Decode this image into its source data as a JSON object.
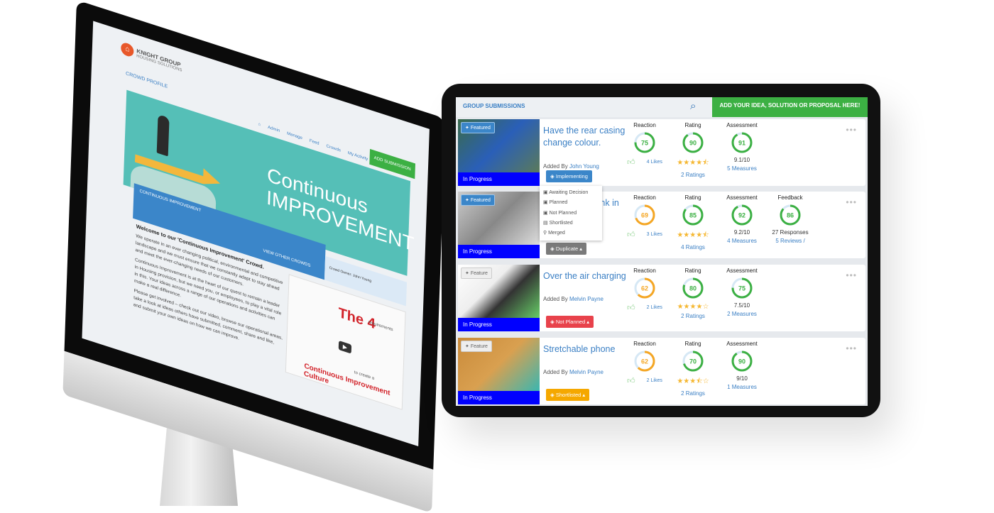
{
  "desktop": {
    "logo": {
      "title": "KNIGHT GROUP",
      "subtitle": "HOUSING SOLUTIONS"
    },
    "crowd_profile": "CROWD PROFILE",
    "nav": [
      "Admin",
      "Manage",
      "Feed",
      "Crowds",
      "My Activity"
    ],
    "banner": {
      "line1": "Continuous",
      "line2": "IMPROVEMENT"
    },
    "add_submission": "ADD SUBMISSION",
    "crowd_bar": "CONTINUOUS IMPROVEMENT",
    "view_other": "VIEW OTHER CROWDS",
    "owner": "Crowd Owner: John Young",
    "welcome": "Welcome to our 'Continuous Improvement' Crowd.",
    "paragraphs": [
      "We operate in an ever changing political, environmental and competitive landscape and we must ensure that we constantly adapt to stay ahead and meet the ever-changing needs of our customers.",
      "Continuous Improvement is at the heart of our quest to remain a leader in Housing provision, but we need you, or employees, to play a vital role in this. Your ideas across a range of our operations and activities can make a real difference.",
      "Please get involved – check out our video, browse our operational areas, take a look at ideas others have submitted, comment, share and like, and submit your own ideas on how we can improve."
    ],
    "video": {
      "big": "The 4",
      "small": "requirements",
      "to": "to create a",
      "culture": "Continuous Improvement Culture"
    }
  },
  "tablet": {
    "header": {
      "title": "GROUP SUBMISSIONS",
      "add_button": "ADD YOUR IDEA, SOLUTION OR PROPOSAL HERE!"
    },
    "dropdown": [
      "Awaiting Decision",
      "Planned",
      "Not Planned",
      "Shortlisted",
      "Merged"
    ],
    "colors": {
      "green": "#3cb043",
      "orange": "#f5a623",
      "blue": "#3b86c9",
      "red": "#e8424b",
      "gray": "#7a7a7a",
      "yellow": "#f5a800"
    },
    "cards": [
      {
        "featured": "Featured",
        "progress": "In Progress",
        "title": "Have the rear casing change colour.",
        "added_by": "Added By",
        "author": "John Young",
        "status": "Implementing",
        "reaction": {
          "label": "Reaction",
          "value": 75,
          "likes": "4 Likes"
        },
        "rating": {
          "label": "Rating",
          "value": 90,
          "stars": 4.5,
          "count": "2 Ratings"
        },
        "assessment": {
          "label": "Assessment",
          "value": 91,
          "score": "9.1/10",
          "measures": "5 Measures"
        }
      },
      {
        "featured": "Featured",
        "progress": "In Progress",
        "title": "...nk in",
        "added_by": "",
        "author": "",
        "status": "Duplicate ▴",
        "reaction": {
          "label": "Reaction",
          "value": 69,
          "likes": "3 Likes"
        },
        "rating": {
          "label": "Rating",
          "value": 85,
          "stars": 4.5,
          "count": "4 Ratings"
        },
        "assessment": {
          "label": "Assessment",
          "value": 92,
          "score": "9.2/10",
          "measures": "4 Measures"
        },
        "feedback": {
          "label": "Feedback",
          "value": 86,
          "responses": "27 Responses",
          "reviews": "5 Reviews /"
        }
      },
      {
        "featured": "Feature",
        "progress": "In Progress",
        "title": "Over the air charging",
        "added_by": "Added By",
        "author": "Melvin Payne",
        "status": "Not Planned ▴",
        "reaction": {
          "label": "Reaction",
          "value": 62,
          "likes": "2 Likes"
        },
        "rating": {
          "label": "Rating",
          "value": 80,
          "stars": 4,
          "count": "2 Ratings"
        },
        "assessment": {
          "label": "Assessment",
          "value": 75,
          "score": "7.5/10",
          "measures": "2 Measures"
        }
      },
      {
        "featured": "Feature",
        "progress": "In Progress",
        "title": "Stretchable phone",
        "added_by": "Added By",
        "author": "Melvin Payne",
        "status": "Shortlisted ▴",
        "reaction": {
          "label": "Reaction",
          "value": 62,
          "likes": "2 Likes"
        },
        "rating": {
          "label": "Rating",
          "value": 70,
          "stars": 3.5,
          "count": "2 Ratings"
        },
        "assessment": {
          "label": "Assessment",
          "value": 90,
          "score": "9/10",
          "measures": "1 Measures"
        }
      }
    ]
  }
}
